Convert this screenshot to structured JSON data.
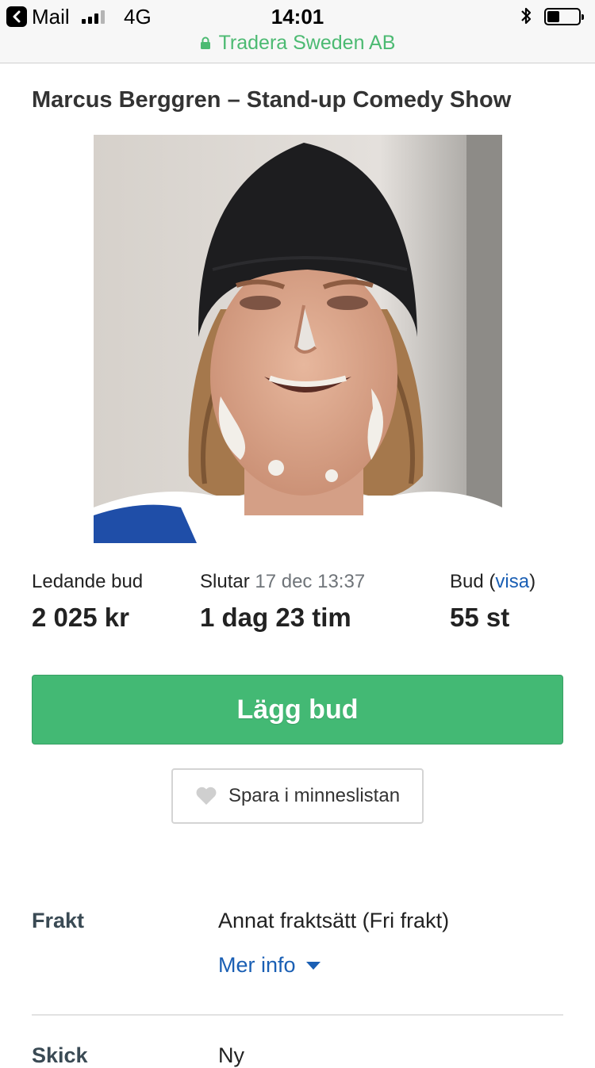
{
  "status_bar": {
    "back_label": "Mail",
    "network": "4G",
    "time": "14:01",
    "battery_level": 0.4,
    "site_name": "Tradera Sweden AB"
  },
  "listing": {
    "title": "Marcus Berggren – Stand-up Comedy Show",
    "leading_bid_label": "Ledande bud",
    "leading_bid_value": "2 025 kr",
    "ends_label": "Slutar",
    "ends_date": "17 dec 13:37",
    "time_left": "1 dag 23 tim",
    "bids_label": "Bud",
    "bids_link": "visa",
    "bids_count": "55 st"
  },
  "actions": {
    "bid_button": "Lägg bud",
    "save_button": "Spara i minneslistan"
  },
  "details": {
    "shipping_label": "Frakt",
    "shipping_value": "Annat fraktsätt (Fri frakt)",
    "more_info": "Mer info",
    "condition_label": "Skick",
    "condition_value": "Ny"
  },
  "colors": {
    "accent_green": "#43b974",
    "site_green": "#4cba72",
    "link_blue": "#1a5fb4"
  },
  "icons": [
    "back-icon",
    "signal-icon",
    "bluetooth-icon",
    "battery-icon",
    "lock-icon",
    "heart-icon",
    "caret-down-icon"
  ]
}
